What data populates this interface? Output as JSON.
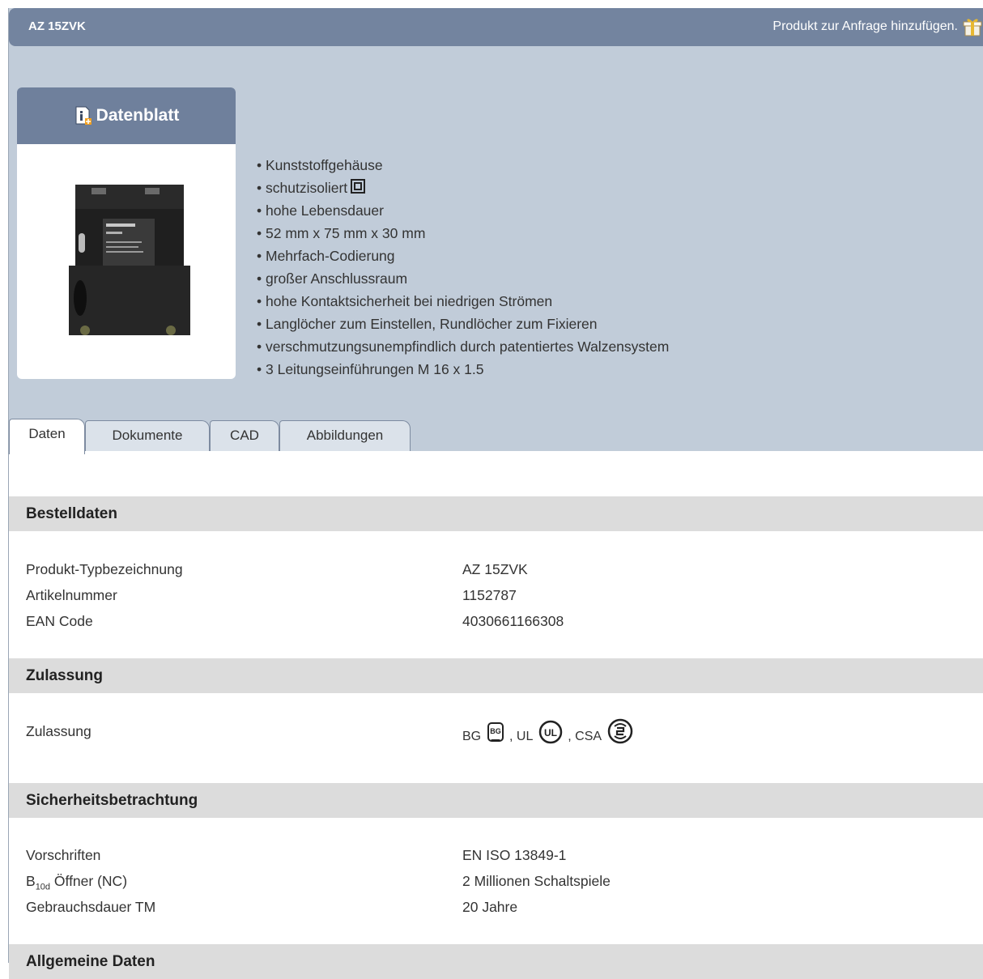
{
  "header": {
    "product_name": "AZ 15ZVK",
    "request_link": "Produkt zur Anfrage hinzufügen."
  },
  "card": {
    "datasheet_label": "Datenblatt"
  },
  "features": [
    "Kunststoffgehäuse",
    "schutzisoliert",
    "hohe Lebensdauer",
    "52 mm x 75 mm x 30 mm",
    "Mehrfach-Codierung",
    "großer Anschlussraum",
    "hohe Kontaktsicherheit bei niedrigen Strömen",
    "Langlöcher zum Einstellen, Rundlöcher zum Fixieren",
    "verschmutzungsunempfindlich durch patentiertes Walzensystem",
    "3 Leitungseinführungen M 16 x 1.5"
  ],
  "tabs": [
    "Daten",
    "Dokumente",
    "CAD",
    "Abbildungen"
  ],
  "sections": {
    "order": {
      "title": "Bestelldaten",
      "rows": [
        {
          "label": "Produkt-Typbezeichnung",
          "value": "AZ 15ZVK"
        },
        {
          "label": "Artikelnummer",
          "value": "1152787"
        },
        {
          "label": "EAN Code",
          "value": "4030661166308"
        }
      ]
    },
    "approval": {
      "title": "Zulassung",
      "label": "Zulassung",
      "bg": "BG",
      "ul": ", UL",
      "csa": ", CSA"
    },
    "safety": {
      "title": "Sicherheitsbetrachtung",
      "rows": [
        {
          "label": "Vorschriften",
          "value": "EN ISO 13849-1"
        },
        {
          "label_main": "B",
          "label_sub": "10d",
          "label_rest": " Öffner (NC)",
          "value": "2 Millionen Schaltspiele"
        },
        {
          "label": "Gebrauchsdauer TM",
          "value": "20 Jahre"
        }
      ]
    },
    "general": {
      "title": "Allgemeine Daten"
    }
  },
  "colors": {
    "header_bar": "#73849f",
    "panel_bg": "#c1ccd9",
    "section_bg": "#dcdcdc"
  }
}
